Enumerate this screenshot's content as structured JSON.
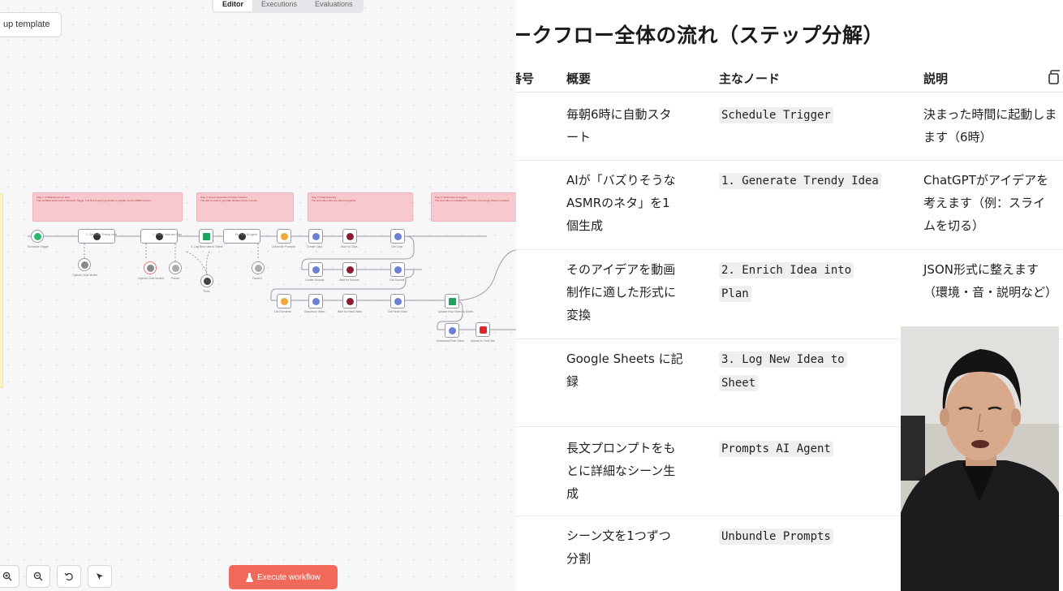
{
  "editor": {
    "tabs": [
      "Editor",
      "Executions",
      "Evaluations"
    ],
    "setup_button": "up template",
    "execute_button": "Execute workflow",
    "sticky_notes": [
      {
        "title": "Step 1: AI Brainstorms an Idea",
        "text": "This workflow starts with a Schedule Trigger. The first AI agent generates a popular, trendy ASMR concept."
      },
      {
        "title": "Step 2: Scene Generation & Video Creation",
        "text": "The plan is used to generate detailed scene prompts."
      },
      {
        "title": "Step 3: Final Assembly",
        "text": "The final video clips are stitched together."
      },
      {
        "title": "Step 4: Distribution & Logging",
        "text": "The final video is uploaded to YouTube, the Google Sheet is updated."
      }
    ],
    "nodes": [
      "Schedule Trigger",
      "1. Generate Trendy Idea",
      "2. Enrich Idea into Plan",
      "3. Log New Idea to Sheet",
      "Prompts AI Agent",
      "Unbundle Prompts",
      "Create Clips",
      "Wait for Clips",
      "Get Clips",
      "Create Sounds",
      "Wait for Sounds",
      "Get Sounds",
      "List Elements",
      "Sequence Video",
      "Wait for Final Video",
      "Get Final Video",
      "Update Row Video to Sheet",
      "Download Final Video",
      "Upload to YouTube",
      "OpenAI Chat Model",
      "OpenAI Chat Model1",
      "Parser",
      "Think",
      "Parser1"
    ]
  },
  "doc": {
    "title": "ークフロー全体の流れ（ステップ分解）",
    "headers": {
      "num": "番号",
      "summary": "概要",
      "node": "主なノード",
      "desc": "説明"
    },
    "rows": [
      {
        "summary": [
          "毎朝6時に自動スタ",
          "ート"
        ],
        "node": "Schedule Trigger",
        "desc": [
          "決まった時間に起動しま",
          "ます（6時）"
        ]
      },
      {
        "summary": [
          "AIが「バズりそうな",
          "ASMRのネタ」を1",
          "個生成"
        ],
        "node": "1. Generate Trendy Idea",
        "desc": [
          "ChatGPTがアイデアを",
          "考えます（例：スライ",
          "ムを切る）"
        ]
      },
      {
        "summary": [
          "そのアイデアを動画",
          "制作に適した形式に",
          "変換"
        ],
        "node": "2. Enrich Idea into Plan",
        "desc": [
          "JSON形式に整えます",
          "（環境・音・説明など）"
        ]
      },
      {
        "summary": [
          "Google Sheets に記",
          "録"
        ],
        "node": "3. Log New Idea to Sheet",
        "desc": []
      },
      {
        "summary": [
          "長文プロンプトをも",
          "とに詳細なシーン生",
          "成"
        ],
        "node": "Prompts AI Agent",
        "desc": []
      },
      {
        "summary": [
          "シーン文を1つずつ",
          "分割"
        ],
        "node": "Unbundle Prompts",
        "desc": []
      }
    ]
  },
  "colors": {
    "accent": "#f0695a",
    "sticky": "#f7c9ce",
    "code_bg": "#efefef"
  }
}
